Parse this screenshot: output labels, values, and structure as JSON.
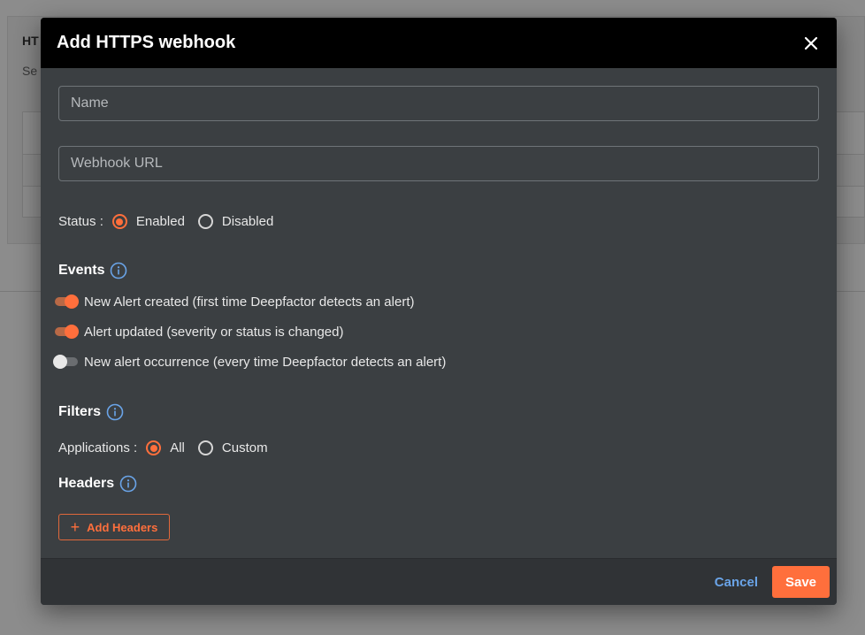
{
  "background": {
    "title": "HT",
    "subtitle": "Se"
  },
  "modal": {
    "title": "Add HTTPS webhook",
    "name_placeholder": "Name",
    "url_placeholder": "Webhook URL",
    "status": {
      "label": "Status :",
      "options": [
        "Enabled",
        "Disabled"
      ],
      "selected": "Enabled"
    },
    "events": {
      "title": "Events",
      "items": [
        {
          "label": "New Alert created (first time Deepfactor detects an alert)",
          "enabled": true
        },
        {
          "label": "Alert updated (severity or status is changed)",
          "enabled": true
        },
        {
          "label": "New alert occurrence (every time Deepfactor detects an alert)",
          "enabled": false
        }
      ]
    },
    "filters": {
      "title": "Filters",
      "applications_label": "Applications :",
      "options": [
        "All",
        "Custom"
      ],
      "selected": "All"
    },
    "headers": {
      "title": "Headers",
      "add_label": "Add Headers"
    },
    "footer": {
      "cancel_label": "Cancel",
      "save_label": "Save"
    }
  },
  "colors": {
    "accent": "#ff6f3c",
    "link": "#6aa4e8",
    "modal_bg": "#3b3f42",
    "header_bg": "#000000"
  }
}
